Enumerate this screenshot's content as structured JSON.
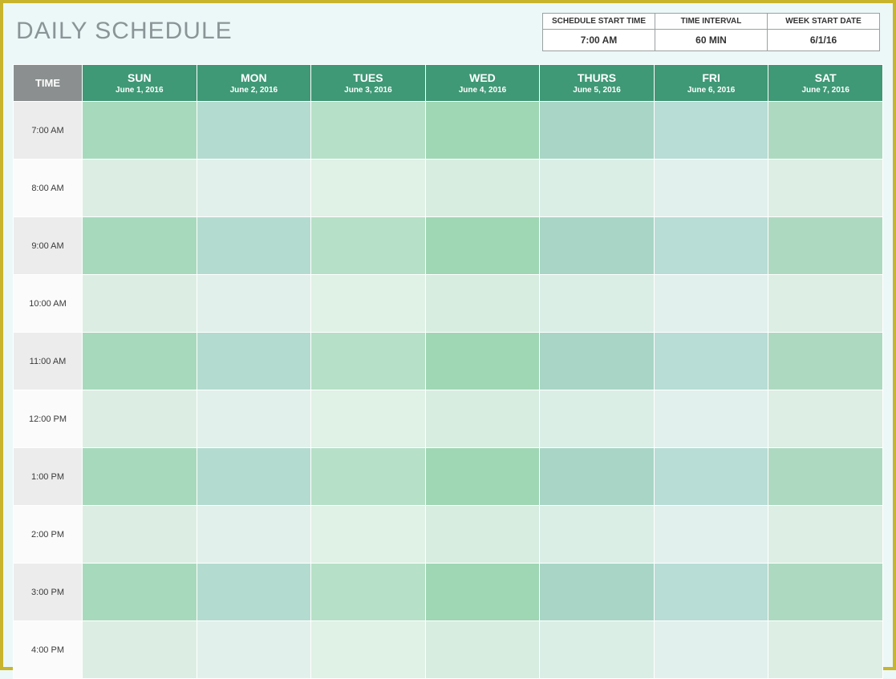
{
  "title": "DAILY SCHEDULE",
  "meta": {
    "headers": [
      "SCHEDULE START TIME",
      "TIME INTERVAL",
      "WEEK START DATE"
    ],
    "values": [
      "7:00 AM",
      "60 MIN",
      "6/1/16"
    ]
  },
  "timeHeader": "TIME",
  "days": [
    {
      "short": "SUN",
      "date": "June 1, 2016"
    },
    {
      "short": "MON",
      "date": "June 2, 2016"
    },
    {
      "short": "TUES",
      "date": "June 3, 2016"
    },
    {
      "short": "WED",
      "date": "June 4, 2016"
    },
    {
      "short": "THURS",
      "date": "June 5, 2016"
    },
    {
      "short": "FRI",
      "date": "June 6, 2016"
    },
    {
      "short": "SAT",
      "date": "June 7, 2016"
    }
  ],
  "times": [
    "7:00 AM",
    "8:00 AM",
    "9:00 AM",
    "10:00 AM",
    "11:00 AM",
    "12:00 PM",
    "1:00 PM",
    "2:00 PM",
    "3:00 PM",
    "4:00 PM"
  ]
}
